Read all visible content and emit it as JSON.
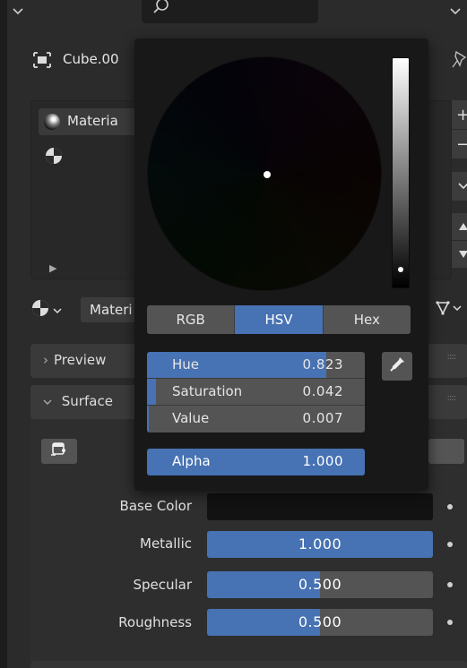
{
  "object": {
    "name": "Cube.00"
  },
  "material_slot": {
    "name": "Materia"
  },
  "material_selector": {
    "name": "Materi"
  },
  "panels": {
    "preview_label": "Preview",
    "surface_label": "Surface"
  },
  "properties": [
    {
      "label": "Base Color",
      "value": "",
      "fraction": 0
    },
    {
      "label": "Metallic",
      "value": "1.000",
      "fraction": 1.0
    },
    {
      "label": "Specular",
      "value": "0.500",
      "fraction": 0.5
    },
    {
      "label": "Roughness",
      "value": "0.500",
      "fraction": 0.5
    }
  ],
  "color_picker": {
    "tabs": [
      {
        "label": "RGB",
        "active": false
      },
      {
        "label": "HSV",
        "active": true
      },
      {
        "label": "Hex",
        "active": false
      }
    ],
    "fields": [
      {
        "name": "Hue",
        "value": "0.823",
        "fraction": 0.823
      },
      {
        "name": "Saturation",
        "value": "0.042",
        "fraction": 0.042
      },
      {
        "name": "Value",
        "value": "0.007",
        "fraction": 0.007
      }
    ],
    "alpha": {
      "name": "Alpha",
      "value": "1.000",
      "fraction": 1.0
    }
  },
  "side_buttons": {
    "add": "+",
    "remove": "−"
  },
  "colors": {
    "accent": "#4772b3",
    "field_bg": "#545454",
    "popup_bg": "#181818",
    "panel_bg": "#2b2b2b"
  },
  "icons": [
    "search-icon",
    "object-icon",
    "pin-icon",
    "material-sphere-icon",
    "material-slot-icon",
    "chevron-down-icon",
    "triangle-up-icon",
    "triangle-down-icon",
    "node-tree-icon",
    "eyedropper-icon",
    "shader-node-icon"
  ]
}
